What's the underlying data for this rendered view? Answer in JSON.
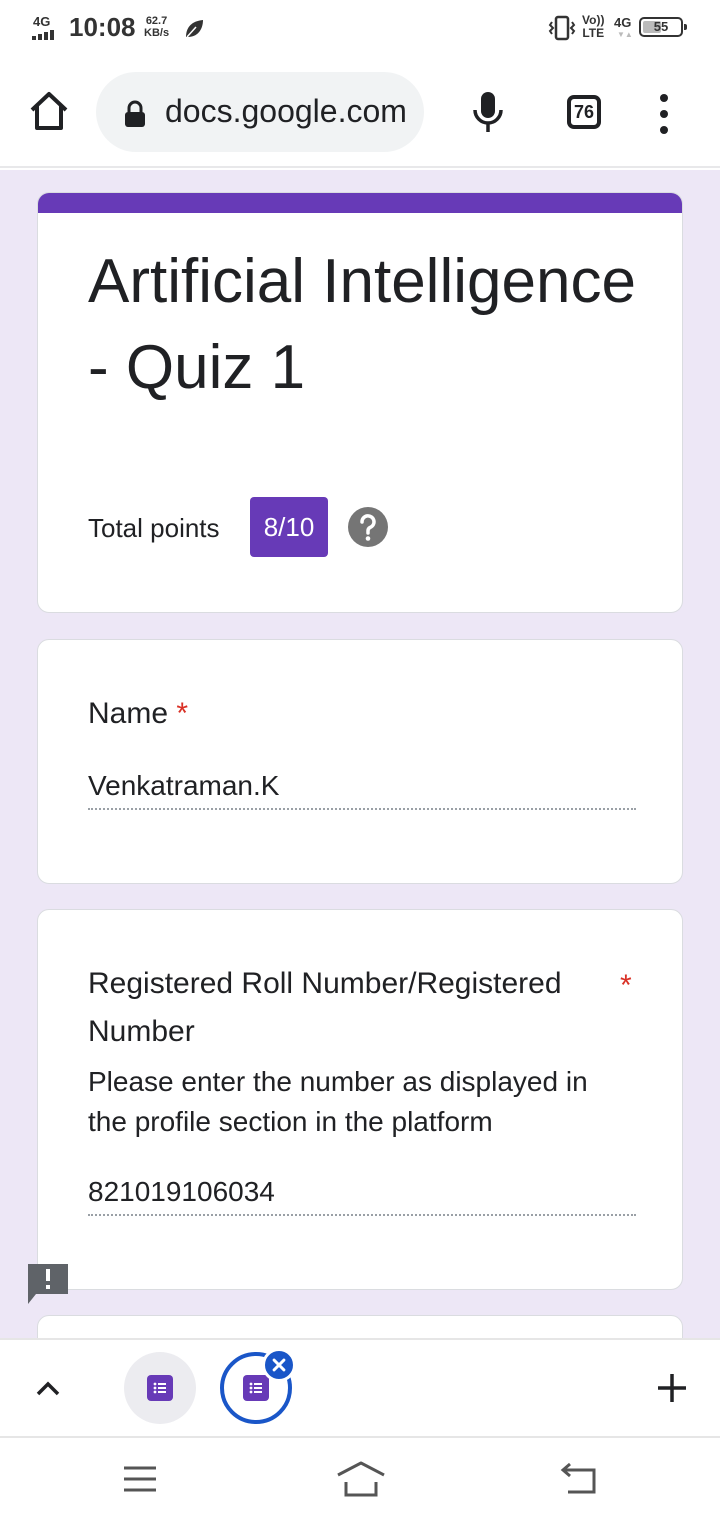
{
  "status_bar": {
    "network_label": "4G",
    "time": "10:08",
    "speed_value": "62.7",
    "speed_unit": "KB/s",
    "volte_top": "Vo))",
    "volte_bottom": "LTE",
    "network2_label": "4G",
    "battery": "55",
    "icons": [
      "signal-icon",
      "leaf-icon",
      "vibrate-icon",
      "battery-icon"
    ]
  },
  "browser": {
    "url": "docs.google.com",
    "tab_count": "76",
    "icons": [
      "home-icon",
      "lock-icon",
      "mic-icon",
      "tab-switcher-icon",
      "more-vert-icon"
    ]
  },
  "form": {
    "accent_color": "#673ab7",
    "background_color": "#ede7f6",
    "title": "Artificial Intelligence - Quiz 1",
    "points_label": "Total points",
    "points_value": "8/10",
    "questions": [
      {
        "title": "Name",
        "required_mark": "*",
        "answer": "Venkatraman.K"
      },
      {
        "title": "Registered Roll Number/Registered Number",
        "required_mark": "*",
        "description": "Please enter the number as displayed in the profile section in the platform",
        "answer": "821019106034"
      }
    ]
  },
  "tab_group": {
    "tabs": [
      {
        "icon": "google-forms-icon",
        "selected": false
      },
      {
        "icon": "google-forms-icon",
        "selected": true
      }
    ],
    "selected_color": "#1a56c8"
  },
  "system_nav": {
    "icons": [
      "recents-icon",
      "home-nav-icon",
      "back-icon"
    ]
  }
}
